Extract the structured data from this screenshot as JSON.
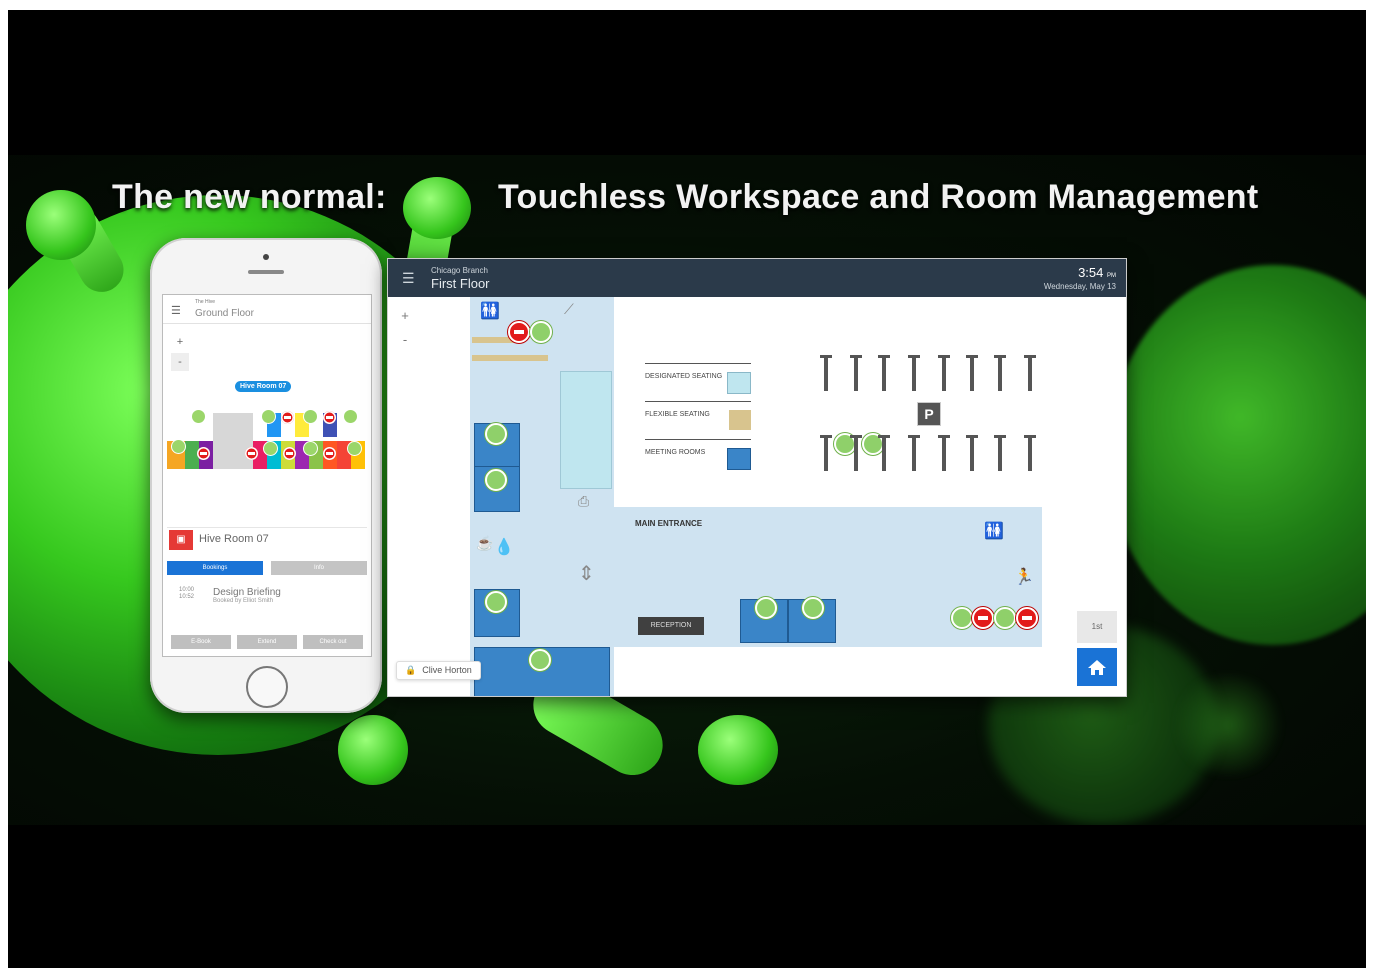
{
  "headline": {
    "left": "The new normal:",
    "right": "Touchless Workspace and Room Management"
  },
  "phone": {
    "branch": "The Hive",
    "floor": "Ground Floor",
    "zoom_in": "+",
    "tooltip": "Hive Room 07",
    "room_name": "Hive Room 07",
    "tabs": [
      "Bookings",
      "Info"
    ],
    "event": {
      "start": "10:00",
      "end": "10:52",
      "title": "Design Briefing",
      "subtitle": "Booked by Elliot Smith"
    },
    "actions": [
      "E-Book",
      "Extend",
      "Check out"
    ]
  },
  "kiosk": {
    "branch": "Chicago Branch",
    "floor": "First Floor",
    "time": "3:54",
    "ampm": "PM",
    "date": "Wednesday, May 13",
    "zoom_in": "+",
    "zoom_out": "-",
    "legend": [
      {
        "label": "DESIGNATED SEATING",
        "color": "#bfe6ef"
      },
      {
        "label": "FLEXIBLE SEATING",
        "color": "#d8c48e"
      },
      {
        "label": "MEETING ROOMS",
        "color": "#3a85c8"
      }
    ],
    "parking_label": "P",
    "main_entrance": "MAIN ENTRANCE",
    "reception": "RECEPTION",
    "floor_button": "1st",
    "user": "Clive Horton"
  },
  "colors": {
    "kiosk_header": "#2b3a4a",
    "home_button": "#1a73d6",
    "booked_red": "#e21b1b",
    "free_green": "#8fd06a",
    "room_blue": "#3a85c8"
  },
  "icons": {
    "menu": "hamburger-icon",
    "home": "home-icon",
    "lock": "lock-icon",
    "restroom": "restroom-icon",
    "accessible": "wheelchair-icon",
    "exit": "running-exit-icon",
    "water": "water-drop-icon",
    "elevator": "elevator-icon"
  }
}
